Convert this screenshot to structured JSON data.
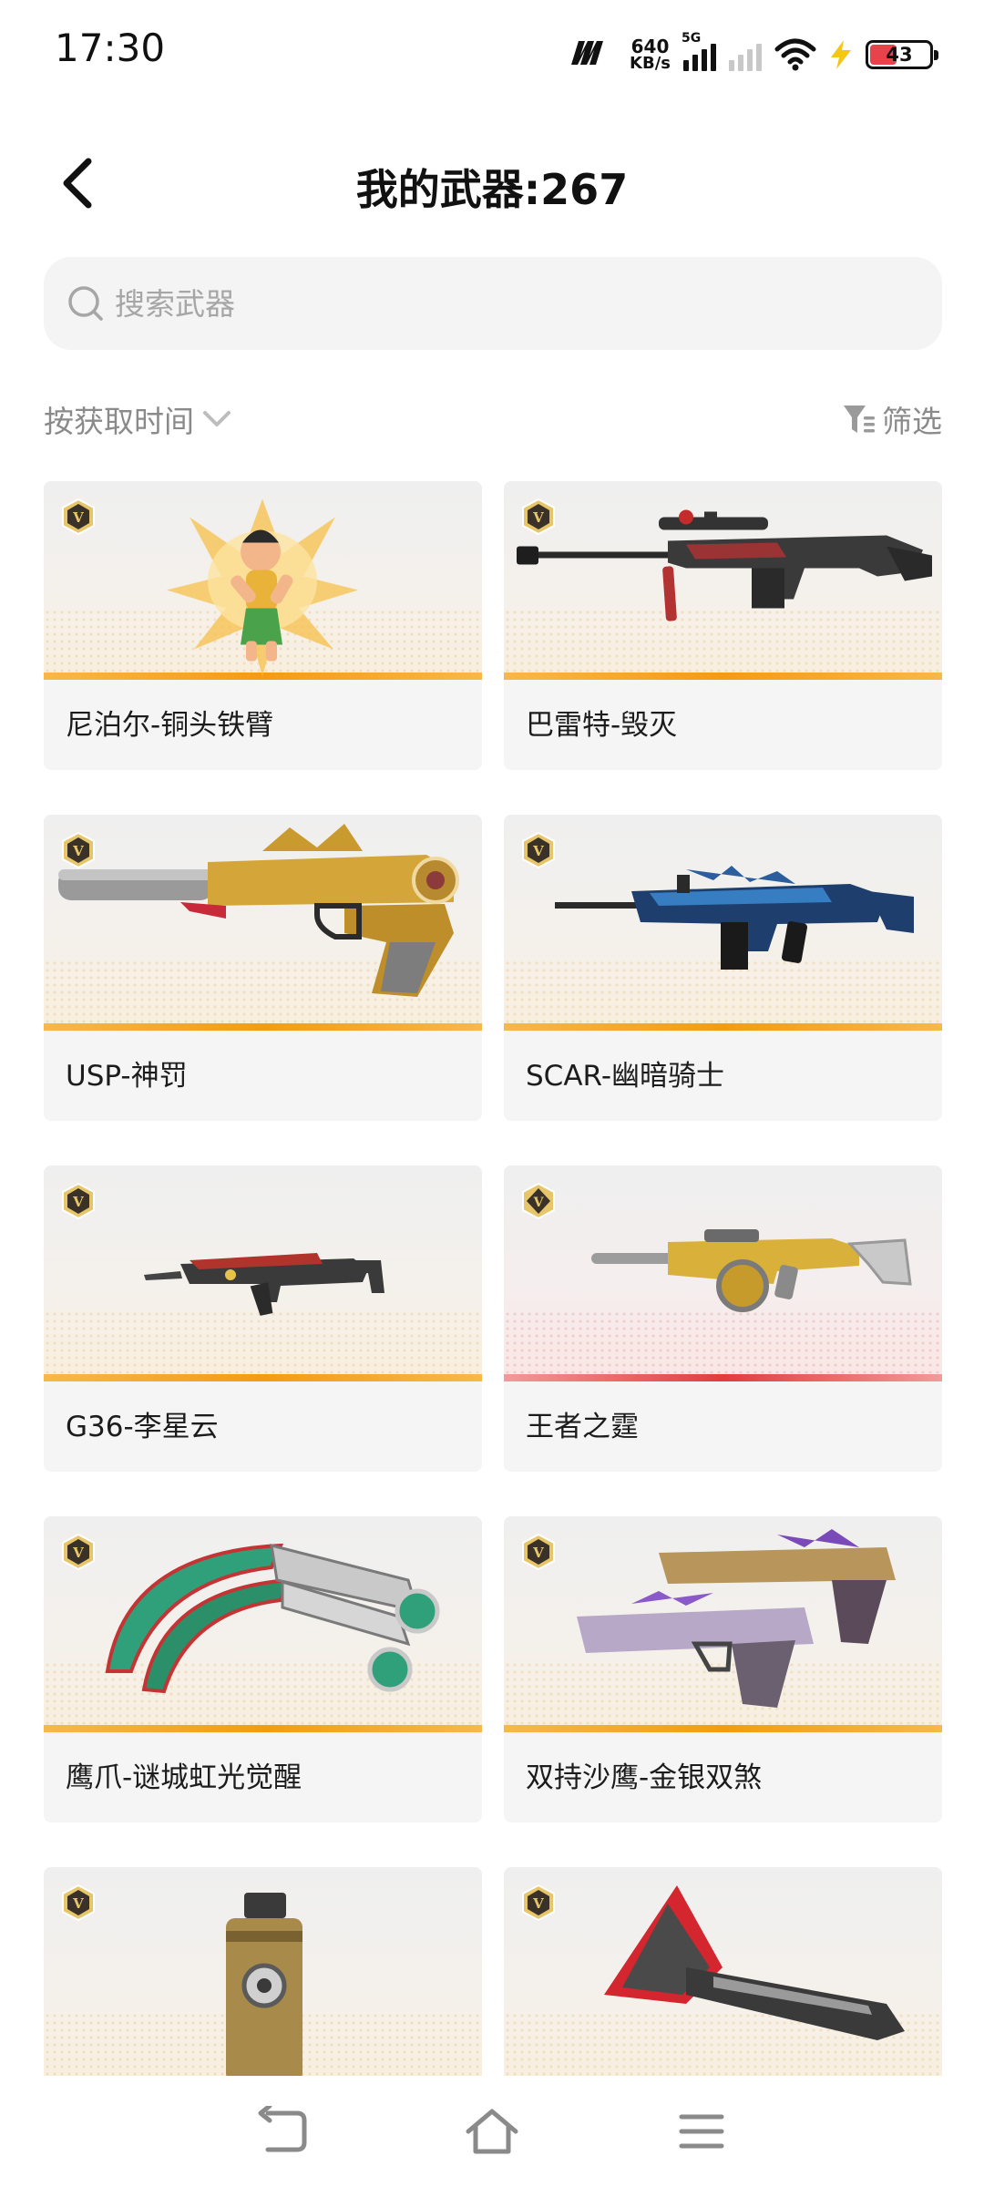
{
  "status_bar": {
    "time": "17:30",
    "net_logo": "m",
    "net_speed_value": "640",
    "net_speed_unit": "KB/s",
    "network_type": "5G",
    "battery_level": "43",
    "battery_color": "#e8434a",
    "charge_color": "#f5c518"
  },
  "header": {
    "title": "我的武器:267",
    "back_icon": "chevron-left-icon"
  },
  "search": {
    "placeholder": "搜索武器",
    "value": ""
  },
  "filters": {
    "sort_label": "按获取时间",
    "filter_label": "筛选"
  },
  "weapons": [
    {
      "name": "尼泊尔-铜头铁臂",
      "badge": "v",
      "accent": "gold"
    },
    {
      "name": "巴雷特-毁灭",
      "badge": "v",
      "accent": "gold"
    },
    {
      "name": "USP-神罚",
      "badge": "v",
      "accent": "gold"
    },
    {
      "name": "SCAR-幽暗骑士",
      "badge": "v",
      "accent": "gold"
    },
    {
      "name": "G36-李星云",
      "badge": "v",
      "accent": "gold"
    },
    {
      "name": "王者之霆",
      "badge": "diamond-v",
      "accent": "red"
    },
    {
      "name": "鹰爪-谜城虹光觉醒",
      "badge": "v",
      "accent": "gold"
    },
    {
      "name": "双持沙鹰-金银双煞",
      "badge": "v",
      "accent": "gold"
    },
    {
      "name": "",
      "badge": "v",
      "accent": "gold"
    },
    {
      "name": "",
      "badge": "v",
      "accent": "gold"
    }
  ],
  "colors": {
    "accent_gold": "#f39c12",
    "accent_red": "#e23c3c",
    "muted_text": "#8a8a8a"
  }
}
